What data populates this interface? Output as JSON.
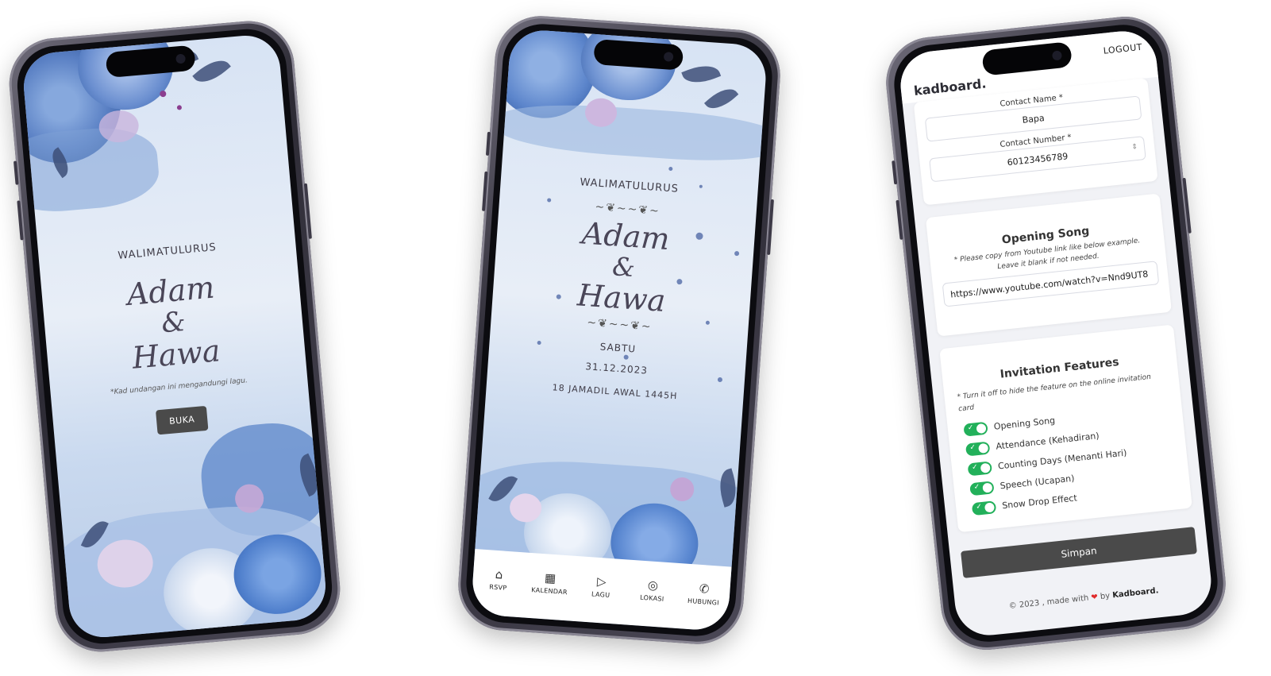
{
  "phone1": {
    "heading": "WALIMATULURUS",
    "name1": "Adam",
    "amp": "&",
    "name2": "Hawa",
    "note": "*Kad undangan ini mengandungi lagu.",
    "open_button": "BUKA"
  },
  "phone2": {
    "heading": "WALIMATULURUS",
    "name1": "Adam",
    "amp": "&",
    "name2": "Hawa",
    "day": "SABTU",
    "date": "31.12.2023",
    "hijri": "18 JAMADIL AWAL 1445H",
    "nav": [
      {
        "label": "RSVP",
        "icon": "rsvp-icon"
      },
      {
        "label": "KALENDAR",
        "icon": "calendar-icon"
      },
      {
        "label": "LAGU",
        "icon": "play-icon"
      },
      {
        "label": "LOKASI",
        "icon": "location-icon"
      },
      {
        "label": "HUBUNGI",
        "icon": "phone-icon"
      }
    ]
  },
  "phone3": {
    "brand": "kadboard.",
    "logout": "LOGOUT",
    "contact_name_label": "Contact Name *",
    "contact_name_value": "Bapa",
    "contact_number_label": "Contact Number *",
    "contact_number_value": "60123456789",
    "song_title": "Opening Song",
    "song_help_1": "* Please copy from Youtube link like below example.",
    "song_help_2": "Leave it blank if not needed.",
    "song_url": "https://www.youtube.com/watch?v=Nnd9UT8",
    "features_title": "Invitation Features",
    "features_help": "* Turn it off to hide the feature on the online invitation card",
    "features": [
      {
        "label": "Opening Song",
        "enabled": true
      },
      {
        "label": "Attendance (Kehadiran)",
        "enabled": true
      },
      {
        "label": "Counting Days (Menanti Hari)",
        "enabled": true
      },
      {
        "label": "Speech (Ucapan)",
        "enabled": true
      },
      {
        "label": "Snow Drop Effect",
        "enabled": true
      }
    ],
    "save_button": "Simpan",
    "footer_prefix": "© 2023 , made with",
    "footer_by": "by",
    "footer_brand": "Kadboard."
  },
  "colors": {
    "toggle_on": "#22b05a",
    "button_dark": "#4a4a4a",
    "floral_blue": "#5b86c9"
  }
}
